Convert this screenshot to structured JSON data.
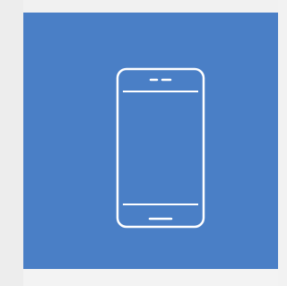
{
  "tile": {
    "icon": "smartphone-icon",
    "background_color": "#4a7fc6",
    "icon_color": "#ffffff"
  }
}
